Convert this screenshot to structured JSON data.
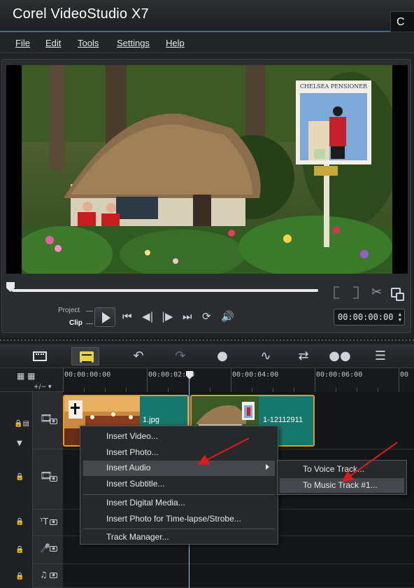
{
  "app": {
    "title": "Corel VideoStudio X7",
    "corner_tab": "C"
  },
  "menu": [
    {
      "label": "File"
    },
    {
      "label": "Edit"
    },
    {
      "label": "Tools"
    },
    {
      "label": "Settings"
    },
    {
      "label": "Help"
    }
  ],
  "preview": {
    "mode_project": "Project",
    "mode_clip": "Clip",
    "timecode": "00:00:00:00",
    "scrub_position": 0,
    "sign_text": "CHELSEA PENSIONER"
  },
  "ruler": {
    "ticks": [
      "00:00:00:00",
      "00:00:02:00",
      "00:00:04:00",
      "00:00:06:00",
      "00"
    ]
  },
  "clips": [
    {
      "label": "1.jpg"
    },
    {
      "label": "1-12112911"
    }
  ],
  "context_menu": {
    "items": [
      {
        "label": "Insert Video..."
      },
      {
        "label": "Insert Photo..."
      },
      {
        "label": "Insert Audio",
        "has_submenu": true,
        "highlighted": true
      },
      {
        "label": "Insert Subtitle..."
      },
      {
        "label": "Insert Digital Media..."
      },
      {
        "label": "Insert Photo for Time-lapse/Strobe..."
      },
      {
        "label": "Track Manager..."
      }
    ]
  },
  "submenu": {
    "items": [
      {
        "label": "To Voice Track..."
      },
      {
        "label": "To Music Track #1...",
        "highlighted": true
      }
    ]
  },
  "colors": {
    "accent_blue": "#2f6bd1",
    "clip_teal": "#15786c",
    "clip_border": "#e79a2a",
    "annotation_arrow": "#e01b1b",
    "storyboard_yellow": "#e8d24a"
  }
}
